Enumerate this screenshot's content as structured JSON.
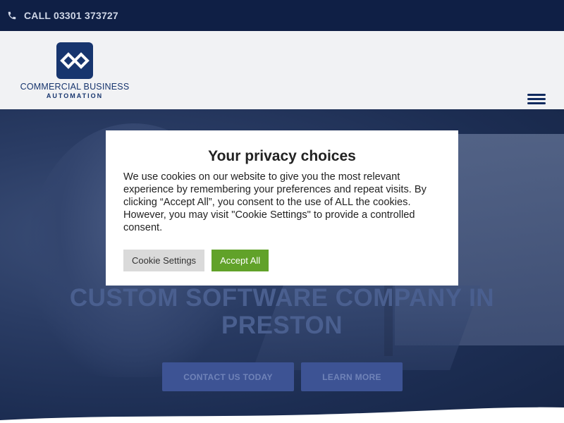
{
  "topbar": {
    "phone_label": "CALL 03301 373727",
    "phone_icon": "phone-icon"
  },
  "brand": {
    "name": "COMMERCIAL BUSINESS",
    "subtitle": "AUTOMATION",
    "color": "#17356e"
  },
  "header": {
    "menu_icon": "hamburger-icon"
  },
  "hero": {
    "title": "CUSTOM SOFTWARE COMPANY IN PRESTON",
    "contact_label": "CONTACT US TODAY",
    "learn_label": "LEARN MORE"
  },
  "cookie_modal": {
    "title": "Your privacy choices",
    "body": "We use cookies on our website to give you the most relevant experience by remembering your preferences and repeat visits. By clicking “Accept All”, you consent to the use of ALL the cookies. However, you may visit \"Cookie Settings\" to provide a controlled consent.",
    "settings_label": "Cookie Settings",
    "accept_label": "Accept All",
    "accept_color": "#61a229"
  }
}
